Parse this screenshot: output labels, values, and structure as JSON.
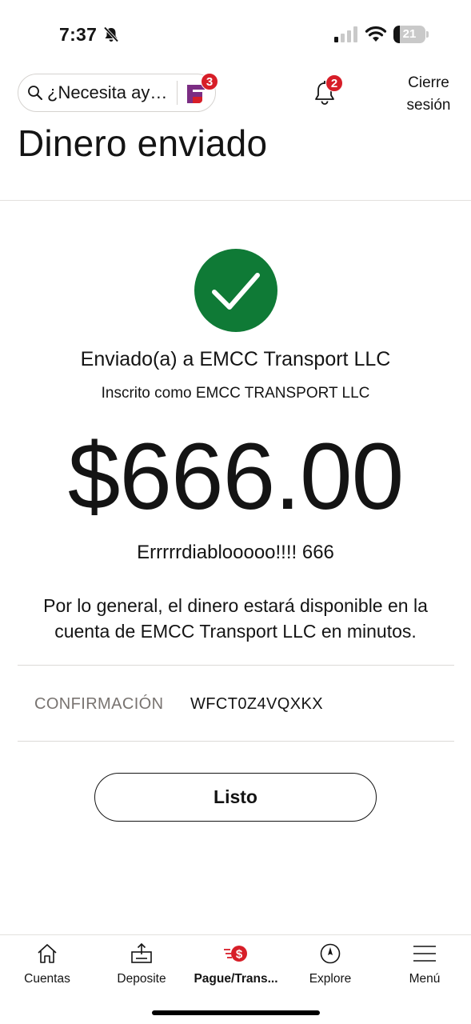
{
  "status_bar": {
    "time": "7:37",
    "battery_level": "21",
    "battery_fraction": 0.21,
    "icons": [
      "bell-slash-icon",
      "cellular-signal-icon",
      "wifi-icon",
      "battery-icon"
    ]
  },
  "header": {
    "search_placeholder": "¿Necesita ay…",
    "fargo_badge_count": "3",
    "notifications_badge_count": "2",
    "logout_line1": "Cierre",
    "logout_line2": "sesión"
  },
  "page": {
    "title": "Dinero enviado"
  },
  "confirmation": {
    "status_icon": "check-circle-icon",
    "sent_to": "Enviado(a) a EMCC Transport LLC",
    "enrolled_as": "Inscrito como EMCC TRANSPORT LLC",
    "amount": "$666.00",
    "memo": "Errrrrdiablooooo!!!! 666",
    "availability_note": "Por lo general, el dinero estará disponible en la cuenta de EMCC Transport LLC en minutos.",
    "confirmation_label": "CONFIRMACIÓN",
    "confirmation_number": "WFCT0Z4VQXKX",
    "done_label": "Listo"
  },
  "tab_bar": {
    "tabs": [
      {
        "label": "Cuentas",
        "icon": "home-icon",
        "active": false
      },
      {
        "label": "Deposite",
        "icon": "deposit-icon",
        "active": false
      },
      {
        "label": "Pague/Trans...",
        "icon": "pay-transfer-icon",
        "active": true
      },
      {
        "label": "Explore",
        "icon": "compass-icon",
        "active": false
      },
      {
        "label": "Menú",
        "icon": "hamburger-menu-icon",
        "active": false
      }
    ]
  },
  "colors": {
    "success_green": "#0f7a36",
    "brand_red": "#d71e28",
    "fargo_purple": "#7b2d83"
  }
}
